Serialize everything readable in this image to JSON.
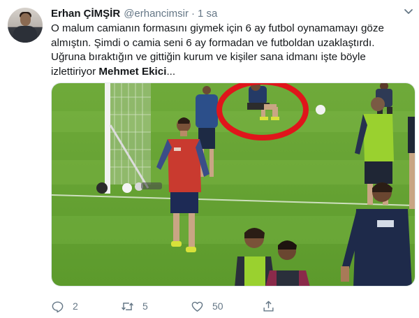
{
  "tweet": {
    "author_name": "Erhan ÇİMŞİR",
    "handle": "@erhancimsir",
    "separator": "·",
    "time": "1 sa",
    "text_lines": [
      "O malum camianın formasını giymek için 6 ay futbol oynamamayı göze",
      "almıştın. Şimdi o camia seni 6 ay formadan ve futboldan uzaklaştırdı.",
      "Uğruna bıraktığın ve gittiğin kurum ve kişiler sana idmanı işte böyle"
    ],
    "last_line_prefix": "izlettiriyor ",
    "mention": "Mehmet Ekici",
    "ellipsis": "...",
    "media_icon": "photo-football-training",
    "highlight_circle_color": "#e0151b"
  },
  "actions": {
    "reply": {
      "icon": "reply-icon",
      "count": "2"
    },
    "retweet": {
      "icon": "retweet-icon",
      "count": "5"
    },
    "like": {
      "icon": "heart-icon",
      "count": "50"
    },
    "share": {
      "icon": "share-icon"
    }
  },
  "colors": {
    "text": "#14171a",
    "secondary": "#657786",
    "border": "#e1e8ed"
  }
}
